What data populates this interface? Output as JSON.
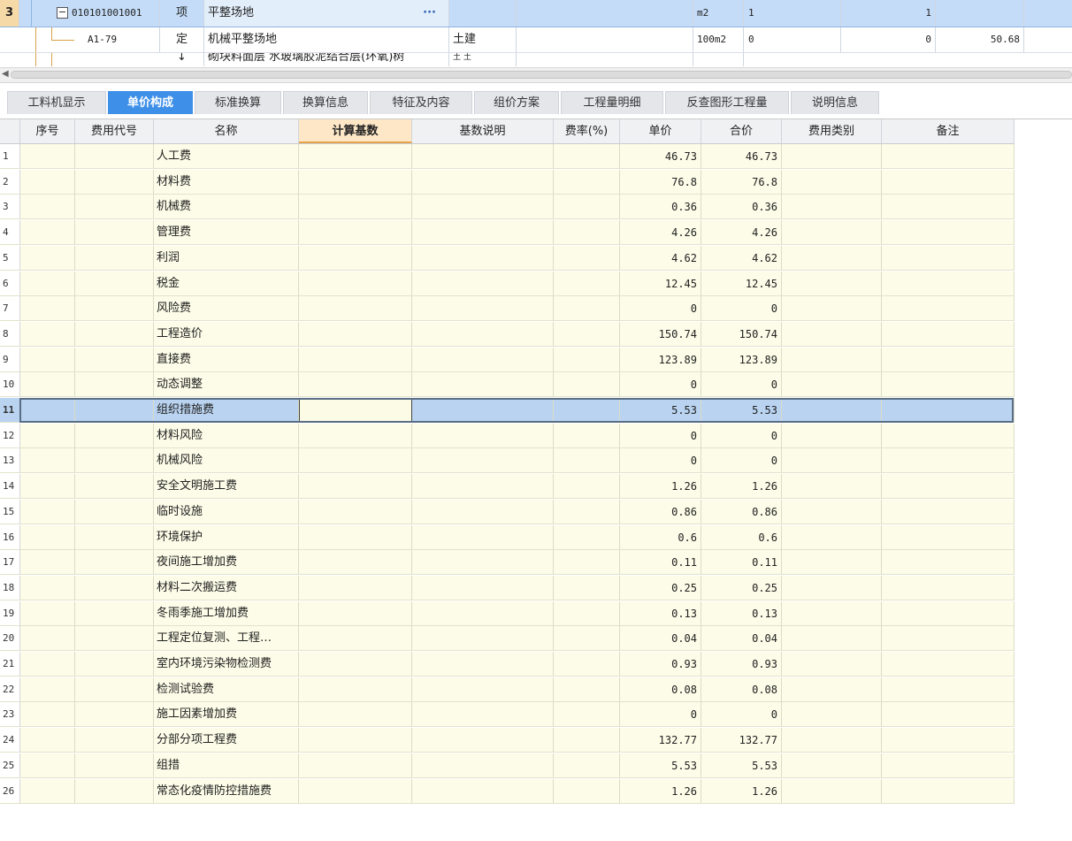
{
  "tree": {
    "row1": {
      "num": "3",
      "code": "010101001001",
      "type": "项",
      "name": "平整场地",
      "ellipsis": "···",
      "unit": "m2",
      "qty": "1",
      "qty2": "1"
    },
    "row2": {
      "code": "A1-79",
      "type": "定",
      "name": "机械平整场地",
      "major": "土建",
      "unit": "100m2",
      "qty": "0",
      "qty2": "0",
      "price": "50.68"
    },
    "row3": {
      "type": "↓",
      "name": "砌块料面层 水玻璃胶泥结合层(环氧)树",
      "major": "土 土"
    }
  },
  "tabs": [
    "工料机显示",
    "单价构成",
    "标准换算",
    "换算信息",
    "特征及内容",
    "组价方案",
    "工程量明细",
    "反查图形工程量",
    "说明信息"
  ],
  "active_tab": "单价构成",
  "columns": [
    "序号",
    "费用代号",
    "名称",
    "计算基数",
    "基数说明",
    "费率(%)",
    "单价",
    "合价",
    "费用类别",
    "备注"
  ],
  "rows": [
    {
      "n": "1",
      "name": "人工费",
      "unit_price": "46.73",
      "total": "46.73"
    },
    {
      "n": "2",
      "name": "材料费",
      "unit_price": "76.8",
      "total": "76.8"
    },
    {
      "n": "3",
      "name": "机械费",
      "unit_price": "0.36",
      "total": "0.36"
    },
    {
      "n": "4",
      "name": "管理费",
      "unit_price": "4.26",
      "total": "4.26"
    },
    {
      "n": "5",
      "name": "利润",
      "unit_price": "4.62",
      "total": "4.62"
    },
    {
      "n": "6",
      "name": "税金",
      "unit_price": "12.45",
      "total": "12.45"
    },
    {
      "n": "7",
      "name": "风险费",
      "unit_price": "0",
      "total": "0"
    },
    {
      "n": "8",
      "name": "工程造价",
      "unit_price": "150.74",
      "total": "150.74"
    },
    {
      "n": "9",
      "name": "直接费",
      "unit_price": "123.89",
      "total": "123.89"
    },
    {
      "n": "10",
      "name": "动态调整",
      "unit_price": "0",
      "total": "0"
    },
    {
      "n": "11",
      "name": "组织措施费",
      "unit_price": "5.53",
      "total": "5.53"
    },
    {
      "n": "12",
      "name": "材料风险",
      "unit_price": "0",
      "total": "0"
    },
    {
      "n": "13",
      "name": "机械风险",
      "unit_price": "0",
      "total": "0"
    },
    {
      "n": "14",
      "name": "安全文明施工费",
      "unit_price": "1.26",
      "total": "1.26"
    },
    {
      "n": "15",
      "name": "临时设施",
      "unit_price": "0.86",
      "total": "0.86"
    },
    {
      "n": "16",
      "name": "环境保护",
      "unit_price": "0.6",
      "total": "0.6"
    },
    {
      "n": "17",
      "name": "夜间施工增加费",
      "unit_price": "0.11",
      "total": "0.11"
    },
    {
      "n": "18",
      "name": "材料二次搬运费",
      "unit_price": "0.25",
      "total": "0.25"
    },
    {
      "n": "19",
      "name": "冬雨季施工增加费",
      "unit_price": "0.13",
      "total": "0.13"
    },
    {
      "n": "20",
      "name": "工程定位复测、工程…",
      "unit_price": "0.04",
      "total": "0.04"
    },
    {
      "n": "21",
      "name": "室内环境污染物检测费",
      "unit_price": "0.93",
      "total": "0.93"
    },
    {
      "n": "22",
      "name": "检测试验费",
      "unit_price": "0.08",
      "total": "0.08"
    },
    {
      "n": "23",
      "name": "施工因素增加费",
      "unit_price": "0",
      "total": "0"
    },
    {
      "n": "24",
      "name": "分部分项工程费",
      "unit_price": "132.77",
      "total": "132.77"
    },
    {
      "n": "25",
      "name": "组措",
      "unit_price": "5.53",
      "total": "5.53"
    },
    {
      "n": "26",
      "name": "常态化疫情防控措施费",
      "unit_price": "1.26",
      "total": "1.26"
    }
  ],
  "selected_row": "11",
  "colors": {
    "accent": "#3d8fe8",
    "row_fill": "#fcfce8",
    "selection": "#b9d3f0"
  }
}
